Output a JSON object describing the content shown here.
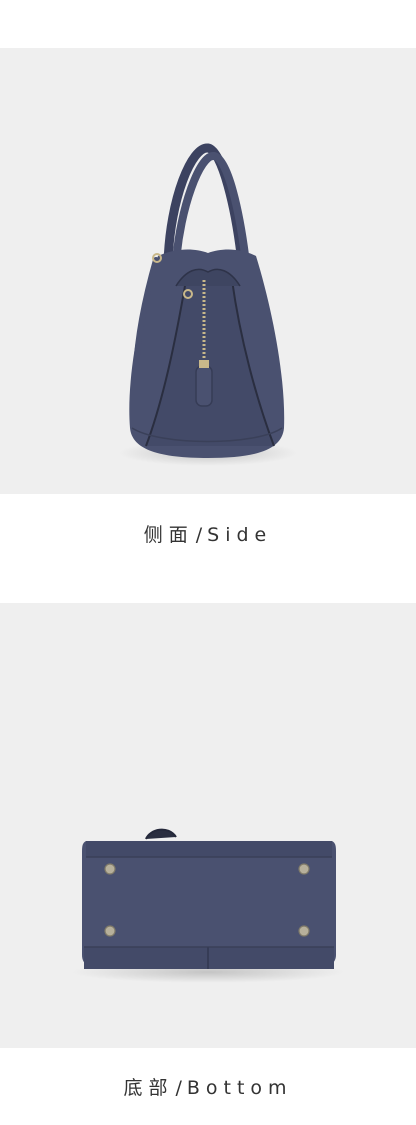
{
  "sections": [
    {
      "caption_cn": "侧面",
      "separator": "/",
      "caption_en": "Side",
      "image_subject": "handbag-side-view"
    },
    {
      "caption_cn": "底部",
      "separator": "/",
      "caption_en": "Bottom",
      "image_subject": "handbag-bottom-view"
    }
  ],
  "colors": {
    "leather": "#4a5170",
    "leather_dark": "#363c56",
    "leather_light": "#5a6284",
    "hardware": "#c9b88a",
    "background": "#efefef",
    "caption_text": "#333333"
  }
}
